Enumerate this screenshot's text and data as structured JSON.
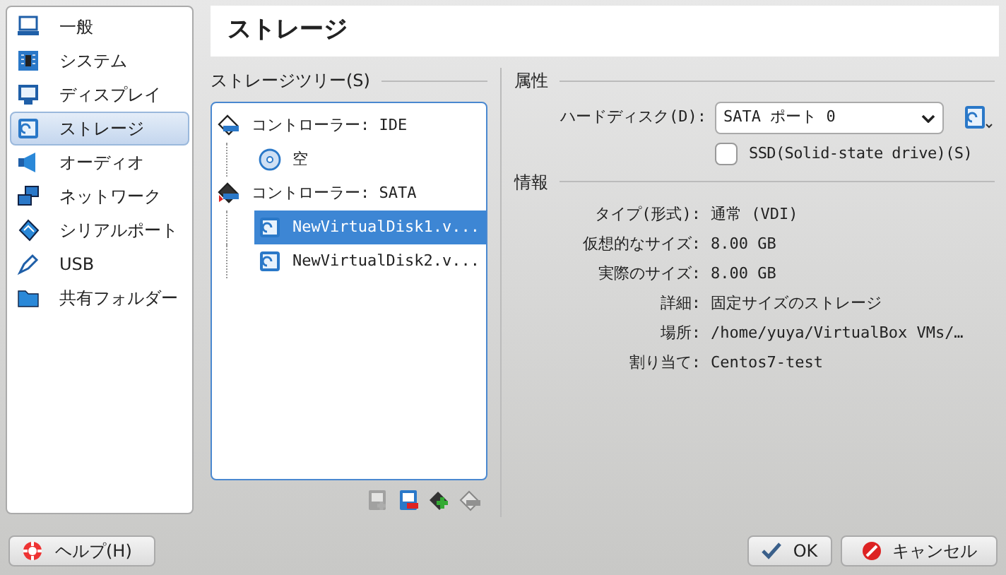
{
  "sidebar": {
    "items": [
      {
        "label": "一般",
        "selected": false
      },
      {
        "label": "システム",
        "selected": false
      },
      {
        "label": "ディスプレイ",
        "selected": false
      },
      {
        "label": "ストレージ",
        "selected": true
      },
      {
        "label": "オーディオ",
        "selected": false
      },
      {
        "label": "ネットワーク",
        "selected": false
      },
      {
        "label": "シリアルポート",
        "selected": false
      },
      {
        "label": "USB",
        "selected": false
      },
      {
        "label": "共有フォルダー",
        "selected": false
      }
    ]
  },
  "page_title": "ストレージ",
  "storage_tree": {
    "label": "ストレージツリー(S)",
    "items": [
      {
        "label": "コントローラー: IDE",
        "children": [
          {
            "kind": "optical",
            "label": "空",
            "selected": false
          }
        ]
      },
      {
        "label": "コントローラー: SATA",
        "children": [
          {
            "kind": "disk",
            "label": "NewVirtualDisk1.v...",
            "selected": true
          },
          {
            "kind": "disk",
            "label": "NewVirtualDisk2.v...",
            "selected": false
          }
        ]
      }
    ],
    "toolbar": [
      {
        "kind": "add-disk",
        "disabled": true
      },
      {
        "kind": "remove-disk",
        "disabled": false
      },
      {
        "kind": "add-controller",
        "disabled": false
      },
      {
        "kind": "remove-controller",
        "disabled": true
      }
    ]
  },
  "attributes": {
    "heading": "属性",
    "hard_disk_label": "ハードディスク(D):",
    "hard_disk_value": "SATA ポート 0",
    "ssd": {
      "label": "SSD(Solid-state drive)(S)",
      "checked": false
    }
  },
  "information": {
    "heading": "情報",
    "rows": [
      {
        "label": "タイプ(形式):",
        "value": "通常 (VDI)"
      },
      {
        "label": "仮想的なサイズ:",
        "value": "8.00 GB"
      },
      {
        "label": "実際のサイズ:",
        "value": "8.00 GB"
      },
      {
        "label": "詳細:",
        "value": "固定サイズのストレージ"
      },
      {
        "label": "場所:",
        "value": "/home/yuya/VirtualBox VMs/…"
      },
      {
        "label": "割り当て:",
        "value": "Centos7-test"
      }
    ]
  },
  "buttons": {
    "help": "ヘルプ(H)",
    "ok": "OK",
    "cancel": "キャンセル"
  }
}
